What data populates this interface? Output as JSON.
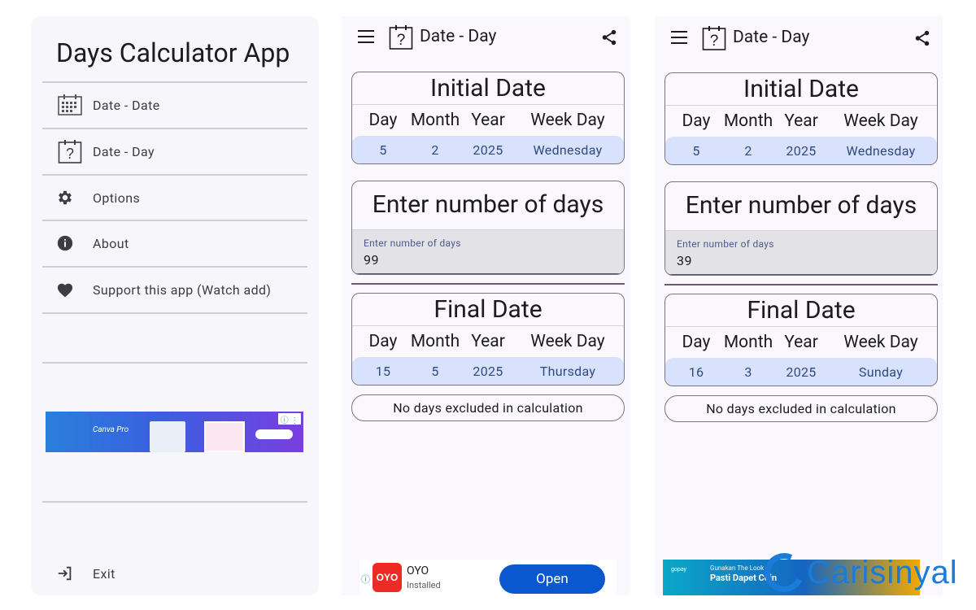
{
  "drawer": {
    "title": "Days Calculator App",
    "items": [
      {
        "label": "Date - Date"
      },
      {
        "label": "Date - Day"
      },
      {
        "label": "Options"
      },
      {
        "label": "About"
      },
      {
        "label": "Support this app (Watch add)"
      }
    ],
    "ad_brand": "Canva Pro",
    "exit_label": "Exit"
  },
  "screens": [
    {
      "title": "Date - Day",
      "initial": {
        "heading": "Initial Date",
        "columns": [
          "Day",
          "Month",
          "Year",
          "Week Day"
        ],
        "values": [
          "5",
          "2",
          "2025",
          "Wednesday"
        ]
      },
      "days_heading": "Enter number of days",
      "days_label": "Enter number of days",
      "days_value": "99",
      "final": {
        "heading": "Final Date",
        "columns": [
          "Day",
          "Month",
          "Year",
          "Week Day"
        ],
        "values": [
          "15",
          "5",
          "2025",
          "Thursday"
        ]
      },
      "excluded": "No days excluded in calculation",
      "ad": {
        "name": "OYO",
        "status": "Installed",
        "button": "Open",
        "logo": "OYO"
      }
    },
    {
      "title": "Date - Day",
      "initial": {
        "heading": "Initial Date",
        "columns": [
          "Day",
          "Month",
          "Year",
          "Week Day"
        ],
        "values": [
          "5",
          "2",
          "2025",
          "Wednesday"
        ]
      },
      "days_heading": "Enter number of days",
      "days_label": "Enter number of days",
      "days_value": "39",
      "final": {
        "heading": "Final Date",
        "columns": [
          "Day",
          "Month",
          "Year",
          "Week Day"
        ],
        "values": [
          "16",
          "3",
          "2025",
          "Sunday"
        ]
      },
      "excluded": "No days excluded in calculation",
      "ad": {
        "line1": "Gunakan The Look",
        "line2": "Pasti Dapet Coin",
        "brand": "gopay"
      }
    }
  ],
  "watermark": "Carisinyal",
  "colors": {
    "accent": "#d9e2fc",
    "divider": "#6d5b73",
    "link": "#0b57d0"
  },
  "icons": [
    "calendar-grid-icon",
    "calendar-question-icon",
    "gear-icon",
    "info-icon",
    "heart-icon",
    "exit-icon",
    "menu-icon",
    "share-icon"
  ]
}
